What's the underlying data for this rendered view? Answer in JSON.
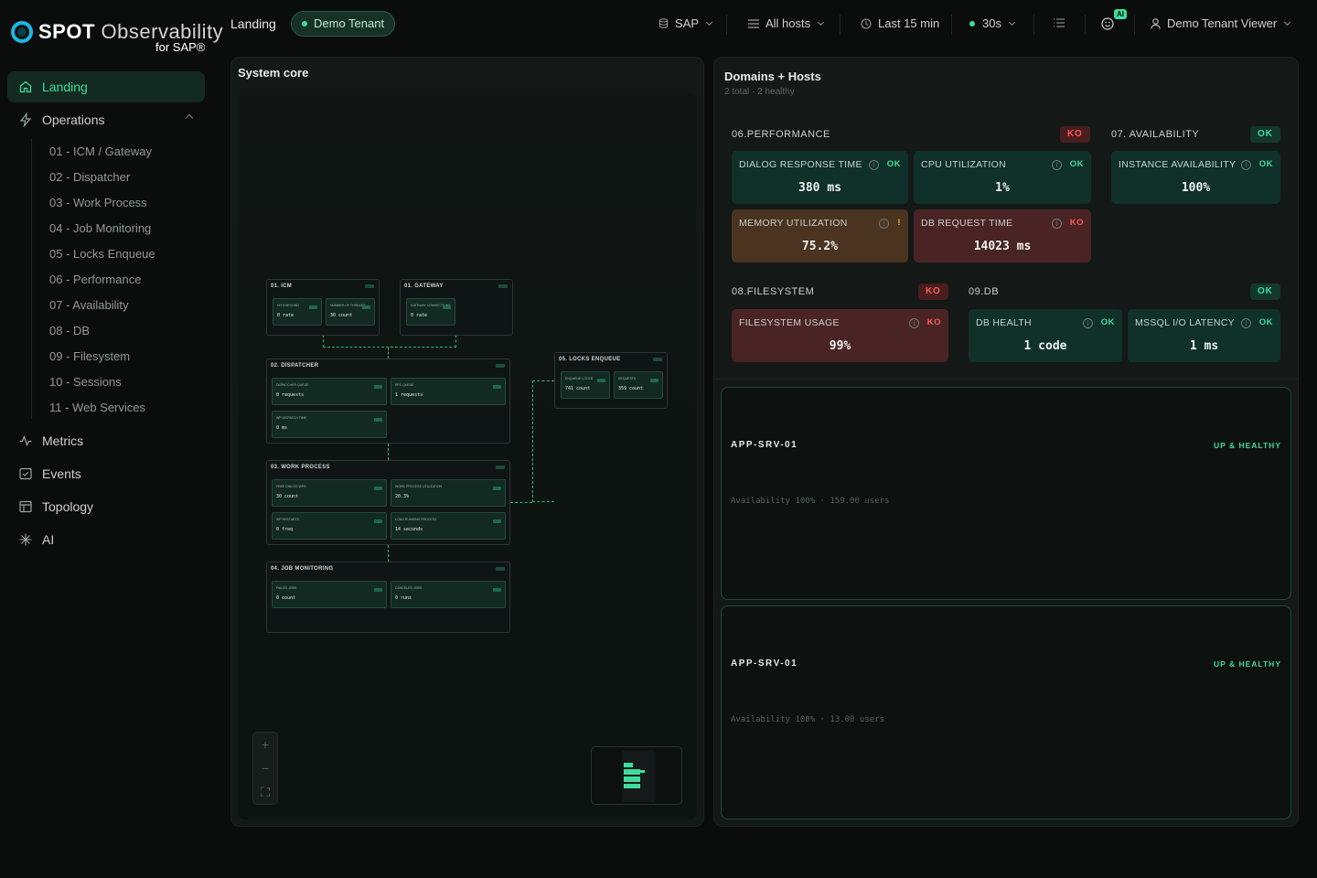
{
  "brand": {
    "name_bold": "SPOT",
    "name_light": "Observability",
    "sub": "for SAP®"
  },
  "sidebar": {
    "items": [
      {
        "label": "Landing"
      },
      {
        "label": "Operations"
      },
      {
        "label": "Metrics"
      },
      {
        "label": "Events"
      },
      {
        "label": "Topology"
      },
      {
        "label": "AI"
      }
    ],
    "operations_children": [
      "01 - ICM / Gateway",
      "02 - Dispatcher",
      "03 - Work Process",
      "04 - Job Monitoring",
      "05 - Locks Enqueue",
      "06 - Performance",
      "07 - Availability",
      "08 - DB",
      "09 - Filesystem",
      "10 - Sessions",
      "11 - Web Services"
    ]
  },
  "header": {
    "title": "Landing",
    "tenant": "Demo Tenant",
    "system": "SAP",
    "hosts": "All hosts",
    "time_range": "Last 15 min",
    "refresh": "30s",
    "ai_badge": "AI",
    "user": "Demo Tenant Viewer"
  },
  "system_core": {
    "title": "System core",
    "groups": [
      {
        "title": "01. ICM",
        "cards": [
          {
            "label": "HITS/SECOND",
            "value": "0 rate"
          },
          {
            "label": "NUMBER OF THREADS",
            "value": "30 count"
          }
        ]
      },
      {
        "title": "01. GATEWAY",
        "cards": [
          {
            "label": "GATEWAY CONNECTIONS",
            "value": "0 rate"
          }
        ]
      },
      {
        "title": "02. DISPATCHER",
        "cards": [
          {
            "label": "DISPATCHER QUEUE",
            "value": "0 requests"
          },
          {
            "label": "RFC QUEUE",
            "value": "1 requests"
          },
          {
            "label": "WP DISPATCH TIME",
            "value": "0 ms"
          }
        ]
      },
      {
        "title": "05. LOCKS ENQUEUE",
        "cards": [
          {
            "label": "ENQUEUE LOCKS",
            "value": "741 count"
          },
          {
            "label": "REQUESTS",
            "value": "359 count"
          }
        ]
      },
      {
        "title": "03. WORK PROCESS",
        "cards": [
          {
            "label": "FREE DIALOG WPS",
            "value": "30 count"
          },
          {
            "label": "WORK PROCESS UTILIZATION",
            "value": "20.3%"
          },
          {
            "label": "WP RESTARTS",
            "value": "0 freq"
          },
          {
            "label": "LONG RUNNING PROCESS",
            "value": "14 seconds"
          }
        ]
      },
      {
        "title": "04. JOB MONITORING",
        "cards": [
          {
            "label": "FAILED JOBS",
            "value": "0 count"
          },
          {
            "label": "CANCELED JOBS",
            "value": "0 runs"
          }
        ]
      }
    ]
  },
  "domains": {
    "title": "Domains + Hosts",
    "subtitle": "2 total · 2 healthy",
    "sections": [
      {
        "label": "06.PERFORMANCE",
        "status": "KO"
      },
      {
        "label": "07. AVAILABILITY",
        "status": "OK"
      },
      {
        "label": "08.FILESYSTEM",
        "status": "KO"
      },
      {
        "label": "09.DB",
        "status": "OK"
      }
    ],
    "metrics": [
      {
        "label": "DIALOG RESPONSE TIME",
        "status": "OK",
        "value": "380 ms"
      },
      {
        "label": "CPU UTILIZATION",
        "status": "OK",
        "value": "1%"
      },
      {
        "label": "INSTANCE AVAILABILITY",
        "status": "OK",
        "value": "100%"
      },
      {
        "label": "MEMORY UTILIZATION",
        "status": "!",
        "value": "75.2%"
      },
      {
        "label": "DB REQUEST TIME",
        "status": "KO",
        "value": "14023 ms"
      },
      {
        "label": "FILESYSTEM USAGE",
        "status": "KO",
        "value": "99%"
      },
      {
        "label": "DB HEALTH",
        "status": "OK",
        "value": "1 code"
      },
      {
        "label": "MSSQL I/O LATENCY",
        "status": "OK",
        "value": "1 ms"
      }
    ],
    "hosts": [
      {
        "name": "APP-SRV-01",
        "status": "UP & HEALTHY",
        "meta": "Availability 100% · 159.00 users"
      },
      {
        "name": "APP-SRV-01",
        "status": "UP & HEALTHY",
        "meta": "Availability 100% · 13.00 users"
      }
    ]
  },
  "colors": {
    "accent": "#3fdc9c",
    "ko": "#ff5a5a",
    "warn": "#f0b429",
    "bg": "#0b0d0d"
  }
}
